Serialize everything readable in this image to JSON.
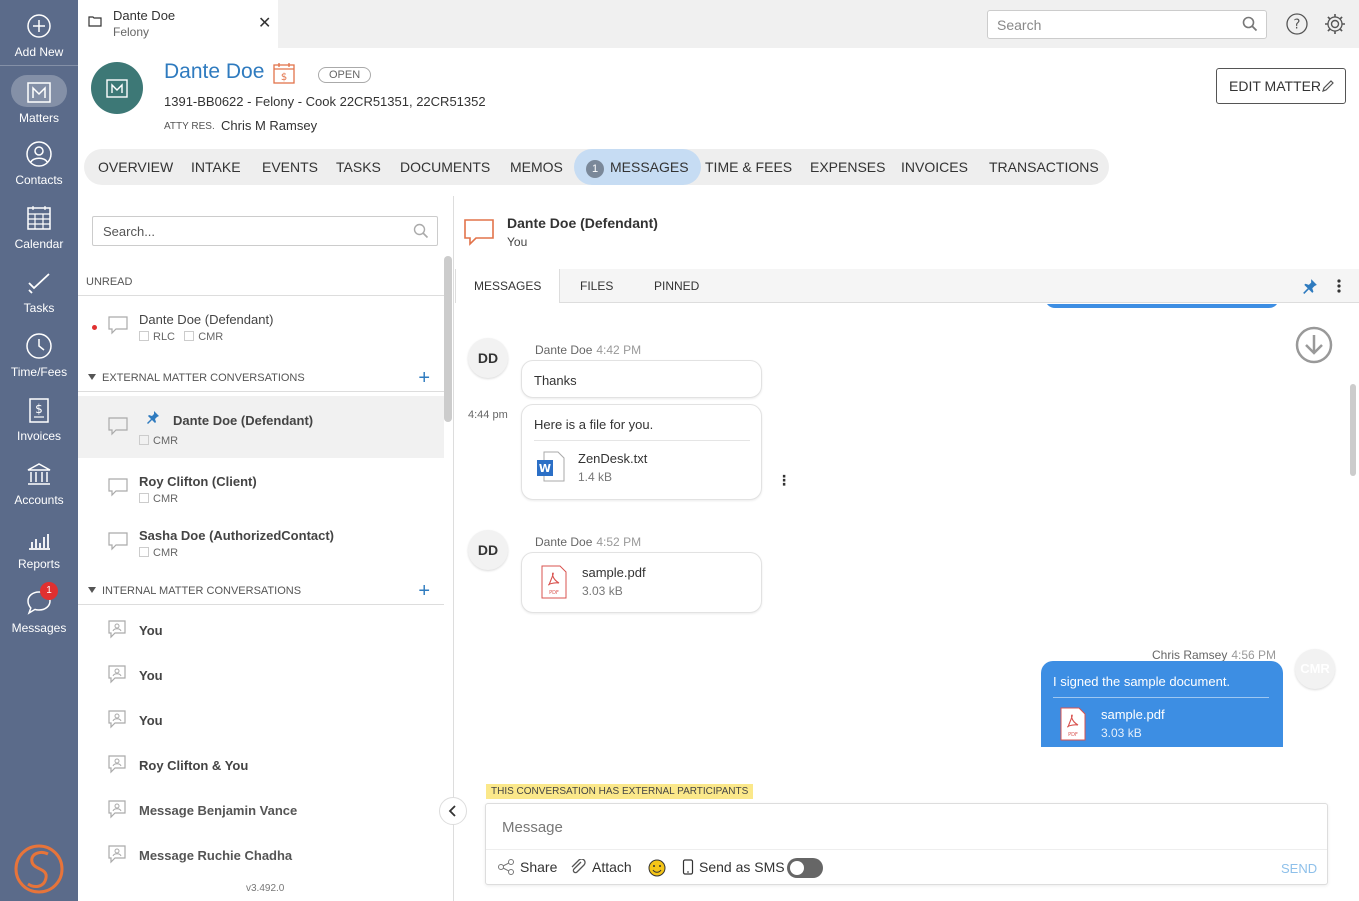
{
  "nav": {
    "add_new": "Add New",
    "matters": "Matters",
    "contacts": "Contacts",
    "calendar": "Calendar",
    "tasks": "Tasks",
    "time_fees": "Time/Fees",
    "invoices": "Invoices",
    "accounts": "Accounts",
    "reports": "Reports",
    "messages": "Messages",
    "messages_badge": "1"
  },
  "topbar": {
    "tab_title": "Dante Doe",
    "tab_subtitle": "Felony",
    "search_placeholder": "Search"
  },
  "matter": {
    "name": "Dante Doe",
    "status": "OPEN",
    "subtitle": "1391-BB0622 - Felony - Cook 22CR51351, 22CR51352",
    "atty_label": "ATTY RES.",
    "atty_value": "Chris M Ramsey",
    "edit_button": "EDIT MATTER"
  },
  "tabs": {
    "overview": "OVERVIEW",
    "intake": "INTAKE",
    "events": "EVENTS",
    "tasks": "TASKS",
    "documents": "DOCUMENTS",
    "memos": "MEMOS",
    "messages": "MESSAGES",
    "messages_count": "1",
    "time_fees": "TIME & FEES",
    "expenses": "EXPENSES",
    "invoices": "INVOICES",
    "transactions": "TRANSACTIONS"
  },
  "conversations": {
    "search_placeholder": "Search...",
    "unread_header": "UNREAD",
    "unread": [
      {
        "name": "Dante Doe (Defendant)",
        "tags": [
          "RLC",
          "CMR"
        ]
      }
    ],
    "external_header": "EXTERNAL MATTER CONVERSATIONS",
    "external": [
      {
        "name": "Dante Doe (Defendant)",
        "tags": [
          "CMR"
        ]
      },
      {
        "name": "Roy Clifton (Client)",
        "tags": [
          "CMR"
        ]
      },
      {
        "name": "Sasha Doe (AuthorizedContact)",
        "tags": [
          "CMR"
        ]
      }
    ],
    "internal_header": "INTERNAL MATTER CONVERSATIONS",
    "internal": [
      {
        "name": "You"
      },
      {
        "name": "You"
      },
      {
        "name": "You"
      },
      {
        "name": "Roy Clifton & You"
      },
      {
        "name": "Message Benjamin Vance"
      },
      {
        "name": "Message Ruchie Chadha"
      }
    ],
    "version": "v3.492.0"
  },
  "conversation_view": {
    "title": "Dante Doe (Defendant)",
    "subtitle": "You",
    "tabs": {
      "messages": "MESSAGES",
      "files": "FILES",
      "pinned": "PINNED"
    },
    "messages": [
      {
        "avatar": "DD",
        "sender": "Dante Doe",
        "time": "4:42 PM",
        "text": "Thanks"
      },
      {
        "side_time": "4:44 pm",
        "text": "Here is a file for you.",
        "file_name": "ZenDesk.txt",
        "file_size": "1.4 kB"
      },
      {
        "avatar": "DD",
        "sender": "Dante Doe",
        "time": "4:52 PM",
        "file_name": "sample.pdf",
        "file_size": "3.03 kB"
      },
      {
        "avatar": "CMR",
        "sender": "Chris Ramsey",
        "time": "4:56 PM",
        "text": "I signed the sample document.",
        "file_name": "sample.pdf",
        "file_size": "3.03 kB"
      }
    ],
    "banner": "THIS CONVERSATION HAS EXTERNAL PARTICIPANTS",
    "composer": {
      "placeholder": "Message",
      "share": "Share",
      "attach": "Attach",
      "sms": "Send as SMS",
      "send": "SEND"
    }
  },
  "colors": {
    "nav_bg": "#5b6b8a",
    "accent": "#2f7bbf",
    "bubble_blue": "#3d8ee3",
    "avatar_teal": "#3d7876"
  }
}
